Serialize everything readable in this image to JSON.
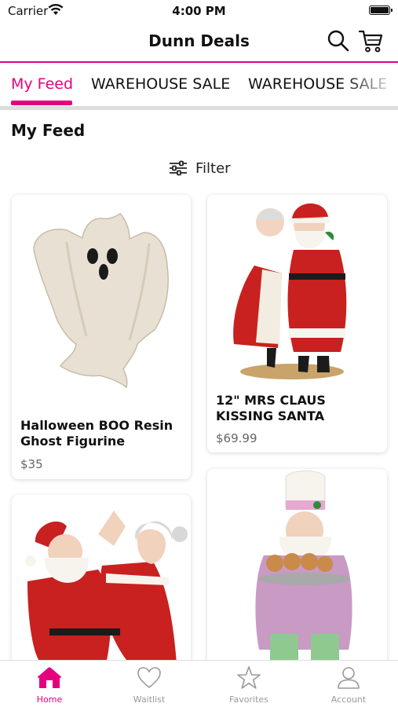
{
  "status_bar": {
    "carrier": "Carrier",
    "time": "4:00 PM"
  },
  "nav": {
    "title": "Dunn Deals",
    "search_icon": "search-icon",
    "cart_icon": "cart-icon"
  },
  "tabs": [
    {
      "label": "My Feed",
      "active": true
    },
    {
      "label": "WAREHOUSE SALE",
      "active": false
    },
    {
      "label": "WAREHOUSE SALE",
      "active": false
    }
  ],
  "section_title": "My Feed",
  "filter": {
    "label": "Filter",
    "icon": "sliders-icon"
  },
  "products": [
    {
      "name": "Halloween BOO Resin Ghost Figurine",
      "price": "$35",
      "image": "ghost-figurine"
    },
    {
      "name": "12\" MRS CLAUS KISSING SANTA",
      "price": "$69.99",
      "image": "santa-mrs-claus-kissing"
    },
    {
      "name": "",
      "price": "",
      "image": "santa-mrs-claus-dancing"
    },
    {
      "name": "",
      "price": "",
      "image": "santa-baker-gingerbread"
    }
  ],
  "tab_bar": [
    {
      "label": "Home",
      "icon": "home-icon",
      "active": true
    },
    {
      "label": "Waitlist",
      "icon": "heart-icon",
      "active": false
    },
    {
      "label": "Favorites",
      "icon": "star-icon",
      "active": false
    },
    {
      "label": "Account",
      "icon": "user-icon",
      "active": false
    }
  ],
  "colors": {
    "accent": "#e6007e",
    "inactive": "#999999"
  }
}
